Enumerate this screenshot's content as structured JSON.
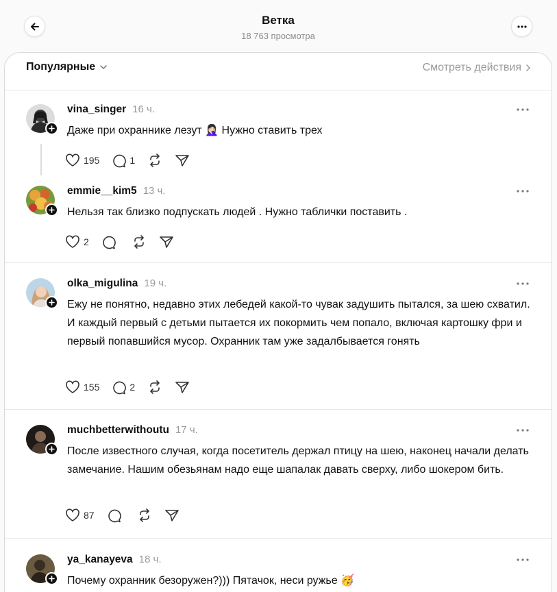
{
  "header": {
    "title": "Ветка",
    "views": "18 763 просмотра"
  },
  "card": {
    "sort_label": "Популярные",
    "activity_label": "Смотреть действия"
  },
  "posts": [
    {
      "username": "vina_singer",
      "time": "16 ч.",
      "text": "Даже при охраннике лезут 🤦🏻‍♀️ Нужно ставить трех",
      "likes": "195",
      "replies": "1",
      "avatar_color": "#3a3a3a"
    },
    {
      "username": "emmie__kim5",
      "time": "13 ч.",
      "text": "Нельзя так близко подпускать людей . Нужно таблички поставить .",
      "likes": "2",
      "replies": "",
      "avatar_color": "#d98a2b"
    },
    {
      "username": "olka_migulina",
      "time": "19 ч.",
      "text": "Ежу не понятно, недавно этих лебедей какой-то чувак задушить пытался, за шею схватил. И каждый первый с детьми пытается их покормить чем попало, включая картошку фри и первый попавшийся мусор. Охранник там уже задалбывается гонять",
      "likes": "155",
      "replies": "2",
      "avatar_color": "#c9a27a"
    },
    {
      "username": "muchbetterwithoutu",
      "time": "17 ч.",
      "text": "После известного случая, когда посетитель держал птицу на шею, наконец начали делать замечание. Нашим обезьянам надо еще шапалак давать сверху, либо шокером бить.",
      "likes": "87",
      "replies": "",
      "avatar_color": "#2b2420"
    },
    {
      "username": "ya_kanayeva",
      "time": "18 ч.",
      "text": "Почему охранник безоружен?))) Пятачок, неси ружье 🥳",
      "likes": "",
      "replies": "",
      "avatar_color": "#4a4030"
    }
  ],
  "icons": {
    "back": "arrow-left-icon",
    "more": "more-horizontal-icon",
    "like": "heart-icon",
    "reply": "comment-icon",
    "repost": "repost-icon",
    "share": "send-icon",
    "follow": "plus-icon",
    "sort": "chevron-down-icon",
    "activity": "chevron-right-icon"
  }
}
